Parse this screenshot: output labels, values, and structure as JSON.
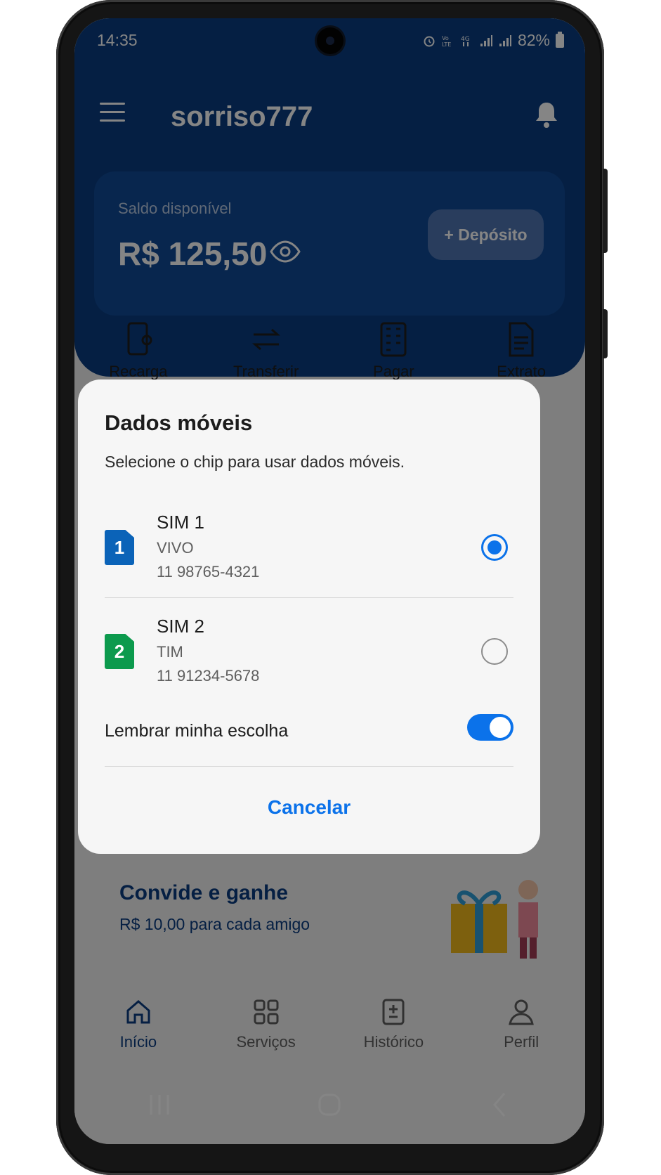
{
  "status_bar": {
    "time": "14:35",
    "battery": "82%"
  },
  "app": {
    "name": "sorriso777",
    "balance": {
      "label": "Saldo disponível",
      "value": "R$ 125,50"
    },
    "deposit_label": "+ Depósito",
    "shortcuts": [
      "Recarga",
      "Transferir",
      "Pagar",
      "Extrato"
    ],
    "promo": {
      "title": "Convide e ganhe",
      "subtitle": "R$ 10,00 para cada amigo"
    },
    "bottom_nav": [
      {
        "label": "Início",
        "active": true
      },
      {
        "label": "Serviços",
        "active": false
      },
      {
        "label": "Histórico",
        "active": false
      },
      {
        "label": "Perfil",
        "active": false
      }
    ]
  },
  "dialog": {
    "title": "Dados móveis",
    "description": "Selecione o chip para usar dados móveis.",
    "sims": [
      {
        "name": "SIM 1",
        "badge": "1",
        "carrier": "VIVO",
        "number": "11 98765-4321",
        "selected": true,
        "color": "#0b63b8"
      },
      {
        "name": "SIM 2",
        "badge": "2",
        "carrier": "TIM",
        "number": "11 91234-5678",
        "selected": false,
        "color": "#0c9a4d"
      }
    ],
    "remember_label": "Lembrar minha escolha",
    "remember_enabled": true,
    "cancel_label": "Cancelar"
  },
  "colors": {
    "primary": "#0b3d80",
    "accent": "#0b72ea"
  }
}
